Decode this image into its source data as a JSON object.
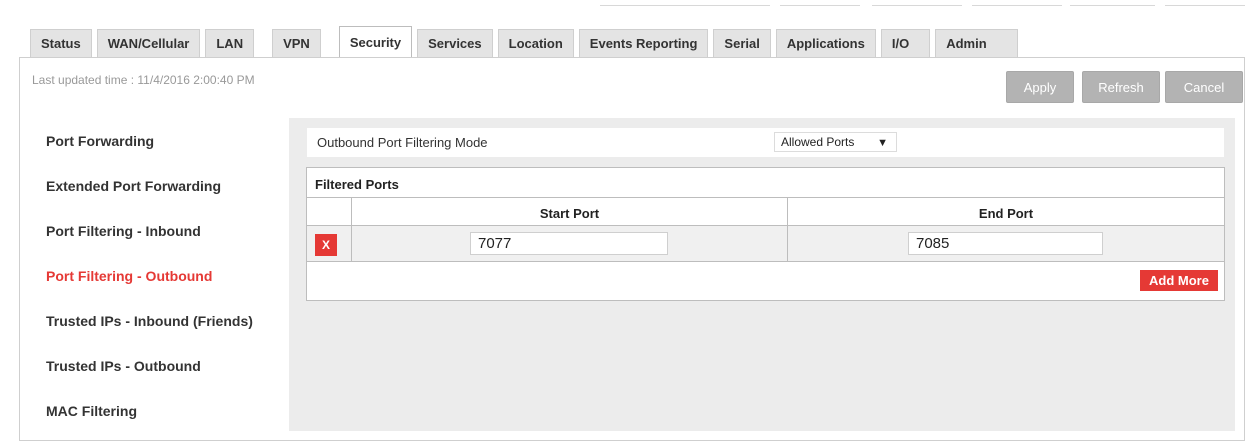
{
  "tabs": [
    {
      "label": "Status"
    },
    {
      "label": "WAN/Cellular"
    },
    {
      "label": "LAN"
    },
    {
      "label": "VPN"
    },
    {
      "label": "Security"
    },
    {
      "label": "Services"
    },
    {
      "label": "Location"
    },
    {
      "label": "Events Reporting"
    },
    {
      "label": "Serial"
    },
    {
      "label": "Applications"
    },
    {
      "label": "I/O"
    },
    {
      "label": "Admin"
    }
  ],
  "active_tab": "Security",
  "last_updated": "Last updated time : 11/4/2016 2:00:40 PM",
  "buttons": {
    "apply": "Apply",
    "refresh": "Refresh",
    "cancel": "Cancel"
  },
  "sidebar": {
    "items": [
      {
        "label": "Port Forwarding"
      },
      {
        "label": "Extended Port Forwarding"
      },
      {
        "label": "Port Filtering - Inbound"
      },
      {
        "label": "Port Filtering - Outbound"
      },
      {
        "label": "Trusted IPs - Inbound (Friends)"
      },
      {
        "label": "Trusted IPs - Outbound"
      },
      {
        "label": "MAC Filtering"
      }
    ],
    "active": "Port Filtering - Outbound"
  },
  "mode": {
    "label": "Outbound Port Filtering Mode",
    "selected": "Allowed Ports"
  },
  "filtered_ports": {
    "title": "Filtered Ports",
    "columns": [
      "Start Port",
      "End Port"
    ],
    "rows": [
      {
        "delete_label": "X",
        "start": "7077",
        "end": "7085"
      }
    ],
    "add_more": "Add More"
  },
  "colors": {
    "accent": "#e53935",
    "button_disabled": "#b3b3b3",
    "content_bg": "#ececec"
  }
}
